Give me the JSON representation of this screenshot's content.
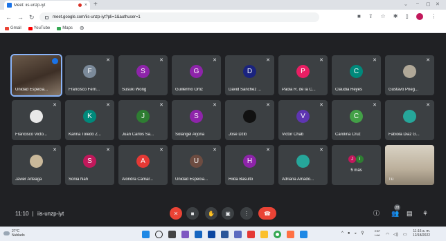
{
  "browser": {
    "tab_title": "Meet: iis-unzp-iyt",
    "tab_close": "×",
    "new_tab": "+",
    "url": "meet.google.com/iis-unzp-iyt?pli=1&authuser=1",
    "bookmarks": [
      {
        "label": "Gmail",
        "color": "#ea4335"
      },
      {
        "label": "YouTube",
        "color": "#ff0000"
      },
      {
        "label": "Maps",
        "color": "#34a853"
      }
    ]
  },
  "participants": [
    {
      "name": "Unidad Especia...",
      "type": "video",
      "col": 0,
      "row": 0
    },
    {
      "name": "Francisco Fern...",
      "type": "initial",
      "initial": "F",
      "color": "#7b8a9a",
      "col": 1,
      "row": 0
    },
    {
      "name": "Susuki Wong",
      "type": "initial",
      "initial": "S",
      "color": "#8e24aa",
      "col": 2,
      "row": 0
    },
    {
      "name": "Guillermo Ortiz",
      "type": "initial",
      "initial": "G",
      "color": "#8e24aa",
      "col": 3,
      "row": 0
    },
    {
      "name": "David Sanchez ...",
      "type": "initial",
      "initial": "D",
      "color": "#1a237e",
      "col": 4,
      "row": 0
    },
    {
      "name": "Paola R. de la C...",
      "type": "initial",
      "initial": "P",
      "color": "#e91e63",
      "col": 5,
      "row": 0
    },
    {
      "name": "Claudia Reyes",
      "type": "initial",
      "initial": "C",
      "color": "#00897b",
      "col": 6,
      "row": 0
    },
    {
      "name": "Gustavo Prieg...",
      "type": "photo",
      "color": "#b0a898",
      "col": 7,
      "row": 0
    },
    {
      "name": "Francisco Victo...",
      "type": "photo",
      "color": "#e8e8e8",
      "col": 0,
      "row": 1
    },
    {
      "name": "Karina Toledo Z...",
      "type": "initial",
      "initial": "K",
      "color": "#00897b",
      "col": 1,
      "row": 1
    },
    {
      "name": "Juan Carlos Sa...",
      "type": "initial",
      "initial": "J",
      "color": "#2e7d32",
      "col": 2,
      "row": 1
    },
    {
      "name": "Solangel Arjona",
      "type": "initial",
      "initial": "S",
      "color": "#8e24aa",
      "col": 3,
      "row": 1
    },
    {
      "name": "José Dzib",
      "type": "photo",
      "color": "#111111",
      "col": 4,
      "row": 1
    },
    {
      "name": "Victor Chab",
      "type": "initial",
      "initial": "V",
      "color": "#5e35b1",
      "col": 5,
      "row": 1
    },
    {
      "name": "Carolina Cruz",
      "type": "initial",
      "initial": "C",
      "color": "#43a047",
      "col": 6,
      "row": 1
    },
    {
      "name": "Fabiola Diaz G...",
      "type": "photo",
      "color": "#26a69a",
      "col": 7,
      "row": 1
    },
    {
      "name": "Javier Arteaga",
      "type": "photo",
      "color": "#c9b89a",
      "col": 0,
      "row": 2
    },
    {
      "name": "Sonia Nah",
      "type": "initial",
      "initial": "S",
      "color": "#c2185b",
      "col": 1,
      "row": 2
    },
    {
      "name": "Alondra Camar...",
      "type": "initial",
      "initial": "A",
      "color": "#e53935",
      "col": 2,
      "row": 2
    },
    {
      "name": "Unidad Especia...",
      "type": "initial",
      "initial": "U",
      "color": "#6d4c41",
      "col": 3,
      "row": 2
    },
    {
      "name": "Hilda Basulto",
      "type": "initial",
      "initial": "H",
      "color": "#8e24aa",
      "col": 4,
      "row": 2
    },
    {
      "name": "Adriana Amado...",
      "type": "photo",
      "color": "#26a69a",
      "col": 5,
      "row": 2
    }
  ],
  "more_tile": {
    "label": "5 más",
    "initials": [
      {
        "letter": "J",
        "color": "#c2185b"
      },
      {
        "letter": "I",
        "color": "#2e7d32"
      }
    ]
  },
  "self_tile": {
    "name": "Tú"
  },
  "meeting": {
    "time": "11:10",
    "separator": "|",
    "code": "iis-unzp-iyt",
    "participant_count": "28"
  },
  "taskbar": {
    "temperature": "27°C",
    "weather": "Nublado",
    "lang_1": "ESP",
    "lang_2": "LAA",
    "time": "11:16 a. m.",
    "date": "12/18/2022"
  },
  "colors": {
    "meet_bg": "#202124",
    "tile_bg": "#3c4043",
    "end_call": "#ea4335",
    "selected_outline": "#8ab4f8"
  }
}
